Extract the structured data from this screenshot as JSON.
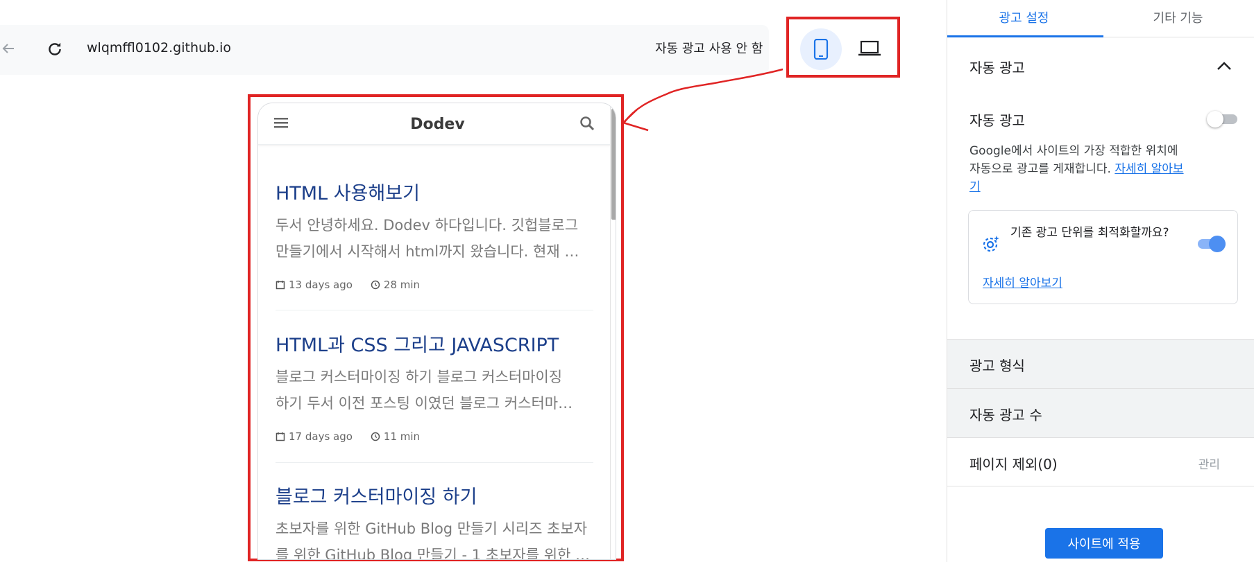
{
  "browser": {
    "url": "wlqmffl0102.github.io",
    "auto_ads_status": "자동 광고 사용 안 함",
    "icons": {
      "back": "arrow-left-icon",
      "reload": "reload-icon",
      "mobile": "mobile-phone-icon",
      "desktop": "laptop-icon"
    }
  },
  "site": {
    "title": "Dodev",
    "posts": [
      {
        "title": "HTML 사용해보기",
        "excerpt_lines": [
          "두서 안녕하세요. Dodev 하다입니다. 깃헙블로그",
          "만들기에서 시작해서 html까지 왔습니다. 현재 …"
        ],
        "date": "13 days ago",
        "read_time": "28 min"
      },
      {
        "title": "HTML과 CSS 그리고 JAVASCRIPT",
        "excerpt_lines": [
          "블로그 커스터마이징 하기 블로그 커스터마이징",
          "하기 두서 이전 포스팅 이였던 블로그 커스터마…"
        ],
        "date": "17 days ago",
        "read_time": "11 min"
      },
      {
        "title": "블로그 커스터마이징 하기",
        "excerpt_lines": [
          "초보자를 위한 GitHub Blog 만들기 시리즈 초보자",
          "를 위한 GitHub Blog 만들기 - 1 초보자를 위한 …"
        ],
        "date": "",
        "read_time": ""
      }
    ]
  },
  "panel": {
    "tabs": [
      {
        "label": "광고 설정",
        "active": true
      },
      {
        "label": "기타 기능",
        "active": false
      }
    ],
    "auto_ads_section": {
      "title": "자동 광고",
      "toggle_label": "자동 광고",
      "toggle_on": false,
      "description": "Google에서 사이트의 가장 적합한 위치에 자동으로 광고를 게재합니다.",
      "learn_more": "자세히 알아보기",
      "optimize_card": {
        "text": "기존 광고 단위를 최적화할까요?",
        "learn_more": "자세히 알아보기",
        "toggle_on": true
      }
    },
    "ad_format_label": "광고 형식",
    "ad_count_label": "자동 광고 수",
    "page_exclusion_label": "페이지 제외(0)",
    "manage_label": "관리",
    "apply_button": "사이트에 적용"
  },
  "colors": {
    "accent": "#1a73e8",
    "highlight_red": "#e02424",
    "post_title": "#1c3f8a"
  }
}
